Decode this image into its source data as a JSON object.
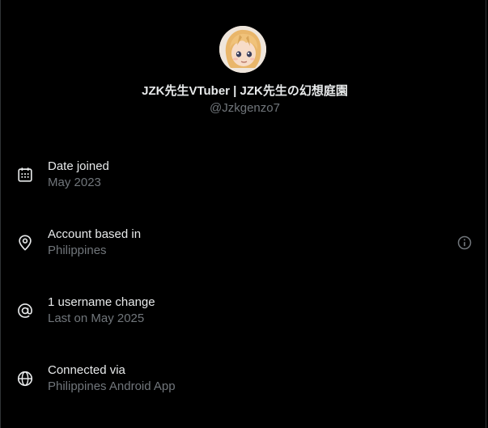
{
  "profile": {
    "display_name": "JZK先生VTuber | JZK先生の幻想庭園",
    "handle": "@Jzkgenzo7"
  },
  "rows": [
    {
      "icon": "calendar-icon",
      "title": "Date joined",
      "subtitle": "May 2023"
    },
    {
      "icon": "location-pin-icon",
      "title": "Account based in",
      "subtitle": "Philippines",
      "has_info": true
    },
    {
      "icon": "at-sign-icon",
      "title": "1 username change",
      "subtitle": "Last on May 2025"
    },
    {
      "icon": "globe-icon",
      "title": "Connected via",
      "subtitle": "Philippines Android App"
    }
  ],
  "colors": {
    "background": "#000000",
    "primary_text": "#e7e9ea",
    "secondary_text": "#71767b",
    "border": "#2f3336"
  }
}
